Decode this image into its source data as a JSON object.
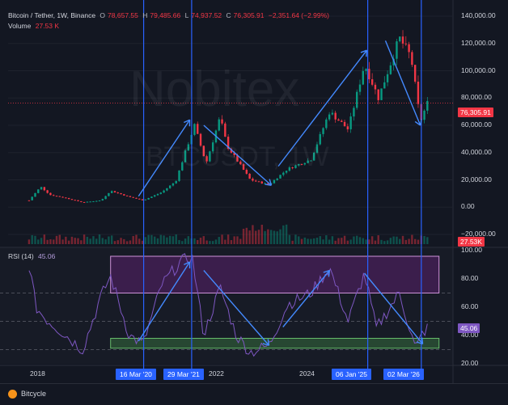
{
  "header": {
    "symbol": "Bitcoin / Tether, 1W, Binance",
    "o_label": "O",
    "o_value": "78,657.55",
    "h_label": "H",
    "h_value": "79,485.66",
    "l_label": "L",
    "l_value": "74,937.52",
    "c_label": "C",
    "c_value": "76,305.91",
    "change": "−2,351.64 (−2.99%)",
    "volume_label": "Volume",
    "volume_value": "27.53 K"
  },
  "watermark": {
    "main": "Nobitex",
    "sub": "BTCUSDT, 1W"
  },
  "price_axis": [
    "140,000.00",
    "120,000.00",
    "100,000.00",
    "80,000.00",
    "60,000.00",
    "40,000.00",
    "20,000.00",
    "0.00",
    "−20,000.00"
  ],
  "last_price_label": "76,305.91",
  "volume_axis_label": "27.53K",
  "rsi": {
    "title": "RSI (14)",
    "value": "45.06",
    "axis": [
      "100.00",
      "80.00",
      "60.00",
      "40.00",
      "20.00"
    ]
  },
  "time_axis": {
    "years": [
      "2018",
      "2022",
      "2024"
    ],
    "dates": [
      "16 Mar '20",
      "29 Mar '21",
      "06 Jan '25",
      "02 Mar '26"
    ]
  },
  "footer": {
    "brand": "Bitcycle"
  },
  "colors": {
    "background": "#131722",
    "up": "#089981",
    "down": "#f23645",
    "accent_blue": "#2962ff",
    "rsi_line": "#7e57c2",
    "overbought_zone": "#9c27b0",
    "oversold_zone": "#4caf50"
  },
  "chart_data": {
    "type": "line",
    "series": [
      {
        "values": [
          [
            2017.75,
            5000
          ],
          [
            2018.0,
            15000
          ],
          [
            2018.2,
            9000
          ],
          [
            2018.5,
            7000
          ],
          [
            2018.9,
            3500
          ],
          [
            2019.3,
            5000
          ],
          [
            2019.5,
            12000
          ],
          [
            2019.9,
            7500
          ],
          [
            2020.2,
            5000
          ],
          [
            2020.6,
            11000
          ],
          [
            2020.9,
            19000
          ],
          [
            2021.1,
            40000
          ],
          [
            2021.3,
            60000
          ],
          [
            2021.55,
            32000
          ],
          [
            2021.85,
            66000
          ],
          [
            2022.0,
            45000
          ],
          [
            2022.5,
            20000
          ],
          [
            2022.9,
            16500
          ],
          [
            2023.3,
            28000
          ],
          [
            2023.8,
            35000
          ],
          [
            2024.2,
            70000
          ],
          [
            2024.6,
            57000
          ],
          [
            2024.95,
            105000
          ],
          [
            2025.25,
            80000
          ],
          [
            2025.7,
            124000
          ],
          [
            2025.95,
            110000
          ],
          [
            2026.15,
            63000
          ],
          [
            2026.3,
            76305.91
          ]
        ]
      }
    ],
    "ylim": [
      -20000,
      140000
    ],
    "volume_last": "27.53K",
    "rsi_series": [
      [
        2017.75,
        90
      ],
      [
        2017.9,
        60
      ],
      [
        2018.1,
        52
      ],
      [
        2018.4,
        44
      ],
      [
        2018.9,
        30
      ],
      [
        2019.3,
        68
      ],
      [
        2019.5,
        82
      ],
      [
        2019.9,
        40
      ],
      [
        2020.2,
        34
      ],
      [
        2020.6,
        76
      ],
      [
        2021.0,
        92
      ],
      [
        2021.25,
        96
      ],
      [
        2021.5,
        40
      ],
      [
        2021.85,
        74
      ],
      [
        2022.2,
        40
      ],
      [
        2022.5,
        28
      ],
      [
        2022.9,
        33
      ],
      [
        2023.3,
        62
      ],
      [
        2023.8,
        70
      ],
      [
        2024.2,
        88
      ],
      [
        2024.6,
        50
      ],
      [
        2024.95,
        84
      ],
      [
        2025.2,
        45
      ],
      [
        2025.7,
        70
      ],
      [
        2026.05,
        30
      ],
      [
        2026.2,
        42
      ],
      [
        2026.3,
        45.06
      ]
    ],
    "rsi_ylim": [
      20,
      100
    ],
    "rsi_levels": [
      70,
      50,
      30
    ],
    "vertical_markers": [
      "16 Mar '20",
      "29 Mar '21",
      "06 Jan '25",
      "02 Mar '26"
    ],
    "marker_positions": [
      2020.21,
      2021.24,
      2025.02,
      2026.17
    ],
    "annotations": [
      "up-arrow",
      "down-arrow",
      "up-arrow",
      "down-arrow"
    ],
    "grid": true
  }
}
